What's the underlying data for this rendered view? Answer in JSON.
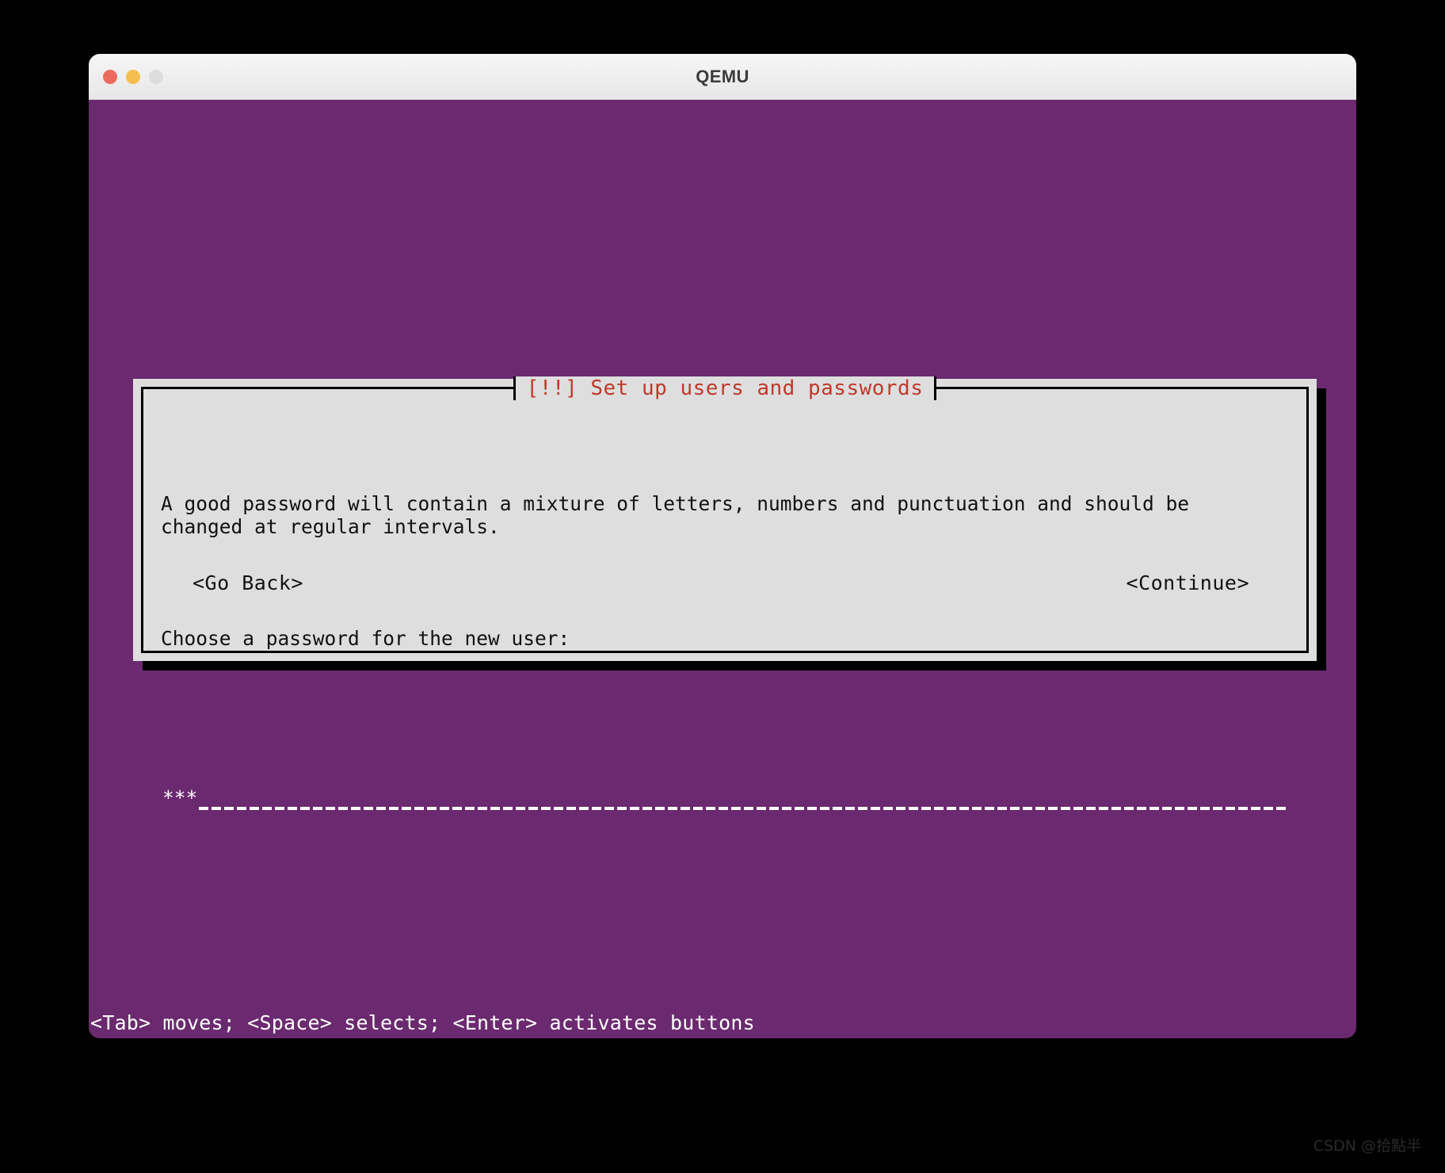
{
  "window": {
    "title": "QEMU",
    "controls": [
      {
        "name": "close",
        "color": "#ed6a5e"
      },
      {
        "name": "minimize",
        "color": "#f5bf4f"
      },
      {
        "name": "zoom",
        "color": "#dddddd"
      }
    ]
  },
  "console": {
    "background_color": "#6b2a70",
    "helpbar_text": "<Tab> moves; <Space> selects; <Enter> activates buttons"
  },
  "dialog": {
    "title": "[!!] Set up users and passwords",
    "title_color": "#c0392b",
    "background_color": "#dedede",
    "border_color": "#000000",
    "paragraphs": [
      "A good password will contain a mixture of letters, numbers and punctuation and should be\nchanged at regular intervals.",
      "Choose a password for the new user:"
    ],
    "password_field": {
      "value": "***",
      "masked": true,
      "field_color": "#6b2a70",
      "text_color": "#ffffff"
    },
    "buttons": {
      "back_label": "<Go Back>",
      "continue_label": "<Continue>"
    }
  },
  "watermark": {
    "text": "CSDN @拾點半"
  }
}
